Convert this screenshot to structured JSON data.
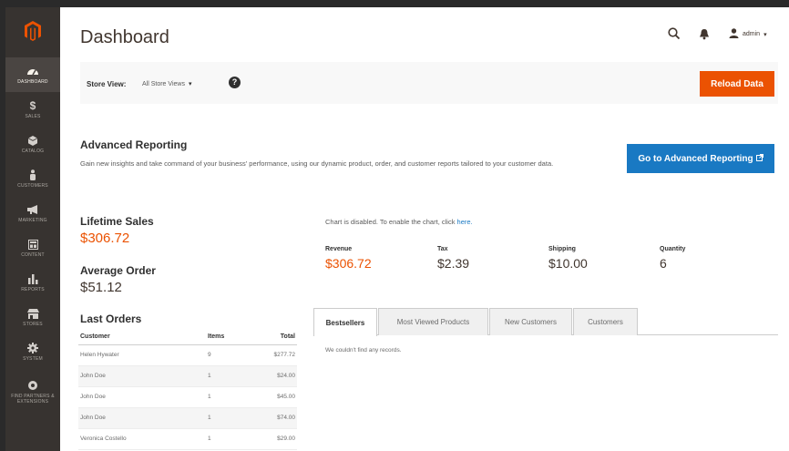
{
  "sidebar": {
    "items": [
      {
        "label": "DASHBOARD",
        "icon": "gauge-icon"
      },
      {
        "label": "SALES",
        "icon": "dollar-icon"
      },
      {
        "label": "CATALOG",
        "icon": "cube-icon"
      },
      {
        "label": "CUSTOMERS",
        "icon": "person-icon"
      },
      {
        "label": "MARKETING",
        "icon": "megaphone-icon"
      },
      {
        "label": "CONTENT",
        "icon": "layout-icon"
      },
      {
        "label": "REPORTS",
        "icon": "bar-chart-icon"
      },
      {
        "label": "STORES",
        "icon": "store-icon"
      },
      {
        "label": "SYSTEM",
        "icon": "gear-icon"
      },
      {
        "label": "FIND PARTNERS & EXTENSIONS",
        "icon": "puzzle-icon"
      }
    ]
  },
  "header": {
    "title": "Dashboard",
    "user": "admin"
  },
  "store_view": {
    "label": "Store View:",
    "selected": "All Store Views",
    "reload_label": "Reload Data"
  },
  "advanced_reporting": {
    "title": "Advanced Reporting",
    "description": "Gain new insights and take command of your business' performance, using our dynamic product, order, and customer reports tailored to your customer data.",
    "button_label": "Go to Advanced Reporting"
  },
  "stats": {
    "lifetime_sales_label": "Lifetime Sales",
    "lifetime_sales_value": "$306.72",
    "average_order_label": "Average Order",
    "average_order_value": "$51.12"
  },
  "last_orders": {
    "title": "Last Orders",
    "columns": [
      "Customer",
      "Items",
      "Total"
    ],
    "rows": [
      [
        "Helen Hywater",
        "9",
        "$277.72"
      ],
      [
        "John Doe",
        "1",
        "$24.00"
      ],
      [
        "John Doe",
        "1",
        "$45.00"
      ],
      [
        "John Doe",
        "1",
        "$74.00"
      ],
      [
        "Veronica Costello",
        "1",
        "$29.00"
      ]
    ]
  },
  "chart_info": {
    "message": "Chart is disabled. To enable the chart, click",
    "link": "here."
  },
  "totals": [
    {
      "label": "Revenue",
      "value": "$306.72"
    },
    {
      "label": "Tax",
      "value": "$2.39"
    },
    {
      "label": "Shipping",
      "value": "$10.00"
    },
    {
      "label": "Quantity",
      "value": "6"
    }
  ],
  "tabs": [
    "Bestsellers",
    "Most Viewed Products",
    "New Customers",
    "Customers"
  ],
  "empty_message": "We couldn't find any records.",
  "colors": {
    "accent": "#eb5202",
    "primary_button": "#1979c3",
    "sidebar": "#373330"
  }
}
